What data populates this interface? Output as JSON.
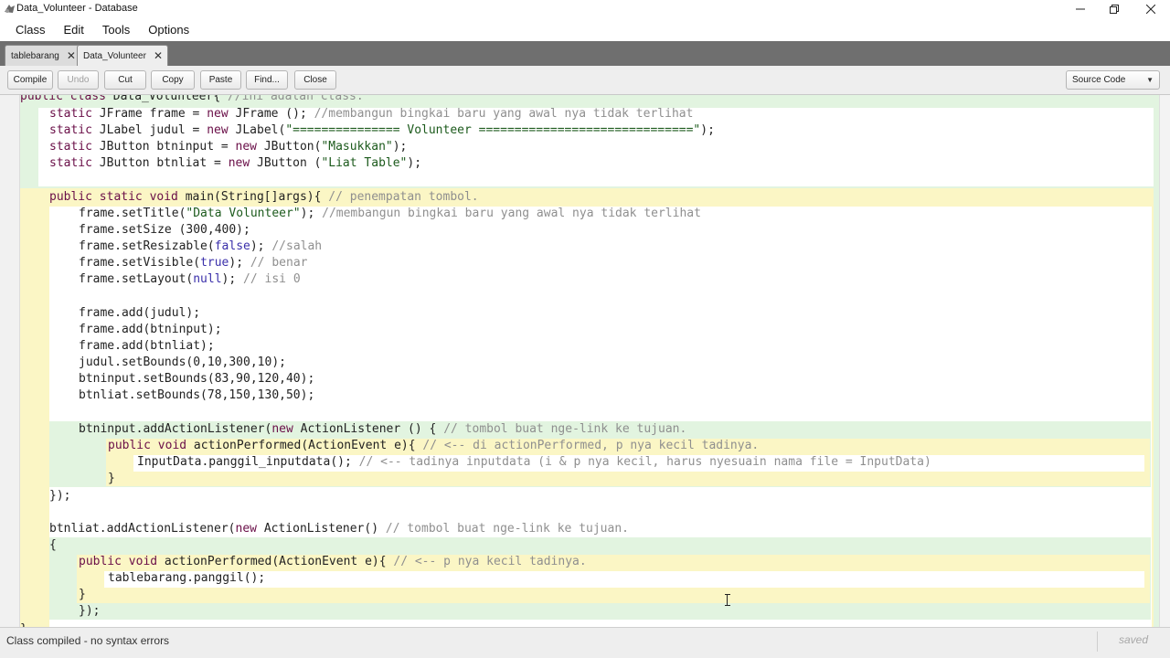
{
  "window": {
    "title": "Data_Volunteer - Database",
    "icon": "bluej-app-icon",
    "controls": [
      "minimize-icon",
      "restore-icon",
      "close-icon"
    ]
  },
  "menu": [
    "Class",
    "Edit",
    "Tools",
    "Options"
  ],
  "tabs": [
    {
      "label": "tablebarang",
      "active": false
    },
    {
      "label": "Data_Volunteer",
      "active": true
    }
  ],
  "toolbar": {
    "compile": "Compile",
    "undo": "Undo",
    "cut": "Cut",
    "copy": "Copy",
    "paste": "Paste",
    "find": "Find...",
    "close": "Close",
    "view_select": "Source Code"
  },
  "code_lines": [
    [
      [
        "kw",
        "public class "
      ],
      [
        "t",
        "Data_Volunteer{ "
      ],
      [
        "cm",
        "//ini adalah class."
      ]
    ],
    [
      [
        "kw",
        "static "
      ],
      [
        "t",
        "JFrame frame = "
      ],
      [
        "kw",
        "new "
      ],
      [
        "t",
        "JFrame (); "
      ],
      [
        "cm",
        "//membangun bingkai baru yang awal nya tidak terlihat"
      ]
    ],
    [
      [
        "kw",
        "static "
      ],
      [
        "t",
        "JLabel judul = "
      ],
      [
        "kw",
        "new "
      ],
      [
        "t",
        "JLabel("
      ],
      [
        "str",
        "\"=============== Volunteer ==============================\""
      ],
      [
        "t",
        ");"
      ]
    ],
    [
      [
        "kw",
        "static "
      ],
      [
        "t",
        "JButton btninput = "
      ],
      [
        "kw",
        "new "
      ],
      [
        "t",
        "JButton("
      ],
      [
        "str",
        "\"Masukkan\""
      ],
      [
        "t",
        ");"
      ]
    ],
    [
      [
        "kw",
        "static "
      ],
      [
        "t",
        "JButton btnliat = "
      ],
      [
        "kw",
        "new "
      ],
      [
        "t",
        "JButton ("
      ],
      [
        "str",
        "\"Liat Table\""
      ],
      [
        "t",
        ");"
      ]
    ],
    [],
    [
      [
        "kw",
        "public static void "
      ],
      [
        "t",
        "main(String[]args){ "
      ],
      [
        "cm",
        "// penempatan tombol."
      ]
    ],
    [
      [
        "t",
        "frame.setTitle("
      ],
      [
        "str",
        "\"Data Volunteer\""
      ],
      [
        "t",
        "); "
      ],
      [
        "cm",
        "//membangun bingkai baru yang awal nya tidak terlihat"
      ]
    ],
    [
      [
        "t",
        "frame.setSize (300,400);"
      ]
    ],
    [
      [
        "t",
        "frame.setResizable("
      ],
      [
        "lit",
        "false"
      ],
      [
        "t",
        "); "
      ],
      [
        "cm",
        "//salah"
      ]
    ],
    [
      [
        "t",
        "frame.setVisible("
      ],
      [
        "lit",
        "true"
      ],
      [
        "t",
        "); "
      ],
      [
        "cm",
        "// benar"
      ]
    ],
    [
      [
        "t",
        "frame.setLayout("
      ],
      [
        "lit",
        "null"
      ],
      [
        "t",
        "); "
      ],
      [
        "cm",
        "// isi 0"
      ]
    ],
    [],
    [
      [
        "t",
        "frame.add(judul);"
      ]
    ],
    [
      [
        "t",
        "frame.add(btninput);"
      ]
    ],
    [
      [
        "t",
        "frame.add(btnliat);"
      ]
    ],
    [
      [
        "t",
        "judul.setBounds(0,10,300,10);"
      ]
    ],
    [
      [
        "t",
        "btninput.setBounds(83,90,120,40);"
      ]
    ],
    [
      [
        "t",
        "btnliat.setBounds(78,150,130,50);"
      ]
    ],
    [],
    [
      [
        "t",
        "btninput.addActionListener("
      ],
      [
        "kw",
        "new "
      ],
      [
        "t",
        "ActionListener () { "
      ],
      [
        "cm",
        "// tombol buat nge-link ke tujuan."
      ]
    ],
    [
      [
        "kw",
        "public void "
      ],
      [
        "t",
        "actionPerformed(ActionEvent e){ "
      ],
      [
        "cm",
        "// <-- di actionPerformed, p nya kecil tadinya."
      ]
    ],
    [
      [
        "t",
        "InputData.panggil_inputdata(); "
      ],
      [
        "cm",
        "// <-- tadinya inputdata (i & p nya kecil, harus nyesuain nama file = InputData)"
      ]
    ],
    [
      [
        "t",
        "}"
      ]
    ],
    [
      [
        "t",
        "});"
      ]
    ],
    [],
    [
      [
        "t",
        "btnliat.addActionListener("
      ],
      [
        "kw",
        "new "
      ],
      [
        "t",
        "ActionListener() "
      ],
      [
        "cm",
        "// tombol buat nge-link ke tujuan."
      ]
    ],
    [
      [
        "t",
        "{"
      ]
    ],
    [
      [
        "kw",
        "public void "
      ],
      [
        "t",
        "actionPerformed(ActionEvent e){ "
      ],
      [
        "cm",
        "// <-- p nya kecil tadinya."
      ]
    ],
    [
      [
        "t",
        "tablebarang.panggil();"
      ]
    ],
    [
      [
        "t",
        "}"
      ]
    ],
    [
      [
        "t",
        "});"
      ]
    ],
    [
      [
        "t",
        "}"
      ]
    ]
  ],
  "status": {
    "message": "Class compiled - no syntax errors",
    "saved": "saved"
  }
}
